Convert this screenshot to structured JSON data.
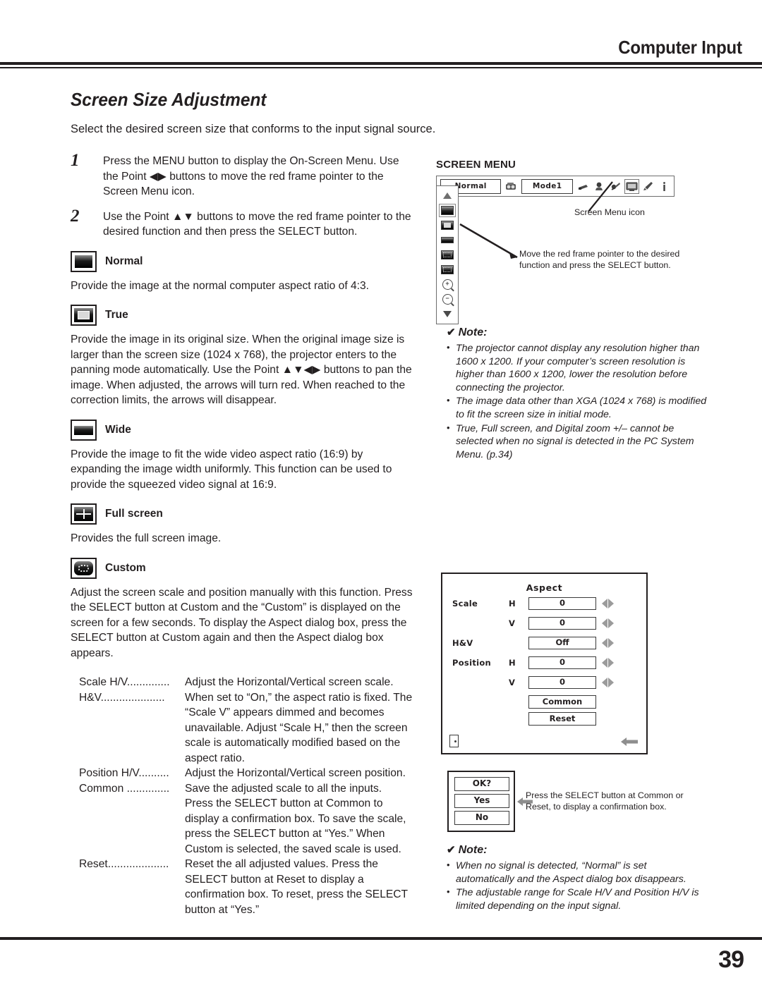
{
  "header": {
    "title": "Computer Input"
  },
  "section": {
    "title": "Screen Size Adjustment",
    "intro": "Select the desired screen size that conforms to the input signal source."
  },
  "steps": [
    {
      "number": "1",
      "text": "Press the MENU button to display the On-Screen Menu. Use the Point ◀▶ buttons to move the red frame pointer to the Screen Menu icon."
    },
    {
      "number": "2",
      "text": "Use the Point ▲▼ buttons to move the red frame pointer to the desired function and then press the SELECT button."
    }
  ],
  "features": [
    {
      "icon": "screen-normal-icon",
      "label": "Normal",
      "body": "Provide the image at the normal computer aspect ratio of 4:3."
    },
    {
      "icon": "screen-true-icon",
      "label": "True",
      "body": "Provide the image in its original size. When the original image size is larger than the screen size (1024 x 768), the projector enters to the panning mode automatically. Use the Point ▲▼◀▶ buttons to pan the image. When adjusted, the arrows will turn red. When reached to the correction limits, the arrows will disappear."
    },
    {
      "icon": "screen-wide-icon",
      "label": "Wide",
      "body": "Provide the image to fit the wide video aspect ratio (16:9) by expanding the image width uniformly. This function can be used to provide the squeezed video signal at 16:9."
    },
    {
      "icon": "screen-full-icon",
      "label": "Full screen",
      "body": "Provides the full screen image."
    },
    {
      "icon": "screen-custom-icon",
      "label": "Custom",
      "body": "Adjust the screen scale and position manually with this function. Press the SELECT button at Custom and the “Custom” is displayed on the screen for a few seconds. To display the Aspect dialog box, press the SELECT button at Custom again and then the Aspect dialog box appears."
    }
  ],
  "definitions": [
    {
      "term": "Scale H/V..............",
      "desc": "Adjust the Horizontal/Vertical screen scale."
    },
    {
      "term": "H&V.....................",
      "desc": "When set to “On,” the aspect ratio is fixed. The “Scale V” appears dimmed and becomes unavailable. Adjust “Scale H,” then the screen scale is automatically modified based on the aspect ratio."
    },
    {
      "term": "Position H/V..........",
      "desc": "Adjust the Horizontal/Vertical screen position."
    },
    {
      "term": "Common ..............",
      "desc": "Save the adjusted scale to all the inputs. Press the SELECT button at Common to display a confirmation box. To save the scale, press the SELECT button at “Yes.” When Custom is selected, the saved scale is used."
    },
    {
      "term": "Reset....................",
      "desc": "Reset the all adjusted values. Press the SELECT button at Reset to display a confirmation box. To reset, press the SELECT button at “Yes.”"
    }
  ],
  "screen_menu": {
    "title": "SCREEN MENU",
    "bar": {
      "input_field": "Normal",
      "mode_field": "Mode1",
      "icons": [
        "projector-icon",
        "printer-icon",
        "color-adjust-icon",
        "settings-icon",
        "screen-menu-icon",
        "pen-icon",
        "info-icon"
      ]
    },
    "sidebar_items": [
      "scroll-up-arrow",
      "normal-icon",
      "true-icon",
      "wide-icon",
      "full-screen-icon",
      "custom-icon",
      "zoom-in-icon",
      "zoom-out-icon",
      "scroll-down-arrow"
    ],
    "callout_icon": "Screen Menu icon",
    "callout_pointer": "Move the red frame pointer to the desired function and press the SELECT button."
  },
  "note_top": {
    "check": "✔",
    "heading": "Note:",
    "items": [
      "The projector cannot display any resolution higher than 1600 x 1200. If your computer’s screen resolution is higher than 1600 x 1200, lower the resolution before connecting the projector.",
      "The image data other than XGA (1024 x 768) is modified to fit the screen size in initial mode.",
      "True, Full screen, and Digital zoom +/– cannot be selected when no signal is detected in the PC System Menu. (p.34)"
    ]
  },
  "aspect_dialog": {
    "title": "Aspect",
    "rows": [
      {
        "label": "Scale",
        "sub": "H",
        "value": "0"
      },
      {
        "label": "",
        "sub": "V",
        "value": "0"
      },
      {
        "label": "H&V",
        "sub": "",
        "value": "Off"
      },
      {
        "label": "Position",
        "sub": "H",
        "value": "0"
      },
      {
        "label": "",
        "sub": "V",
        "value": "0"
      }
    ],
    "buttons": [
      "Common",
      "Reset"
    ],
    "exit_icon": "exit-door-icon",
    "back_icon": "back-arrow-icon"
  },
  "ok_dialog": {
    "title": "OK?",
    "yes": "Yes",
    "no": "No",
    "caption": "Press the SELECT button at Common or Reset, to display a confirmation box."
  },
  "note_bottom": {
    "check": "✔",
    "heading": "Note:",
    "items": [
      "When no signal is detected, “Normal” is set automatically and the Aspect dialog box disappears.",
      "The adjustable range for Scale H/V and Position H/V is limited depending on the input signal."
    ]
  },
  "footer": {
    "page_number": "39"
  }
}
